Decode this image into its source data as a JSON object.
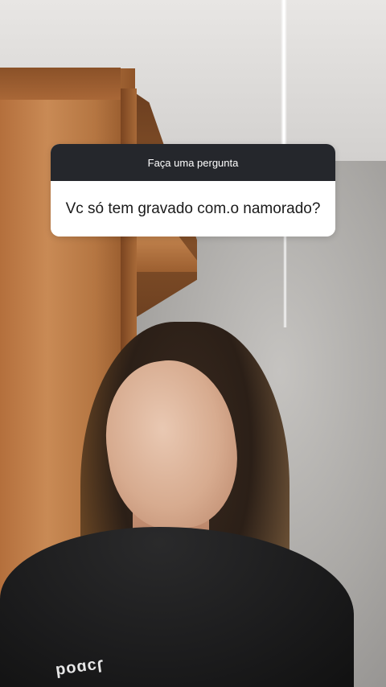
{
  "question_sticker": {
    "header": "Faça uma pergunta",
    "question": "Vc só tem gravado com.o namorado?"
  },
  "shirt_print": "ɿɔɒoq",
  "colors": {
    "sticker_header_bg": "#25272c",
    "sticker_body_bg": "#ffffff",
    "sticker_text": "#1a1a1a"
  }
}
